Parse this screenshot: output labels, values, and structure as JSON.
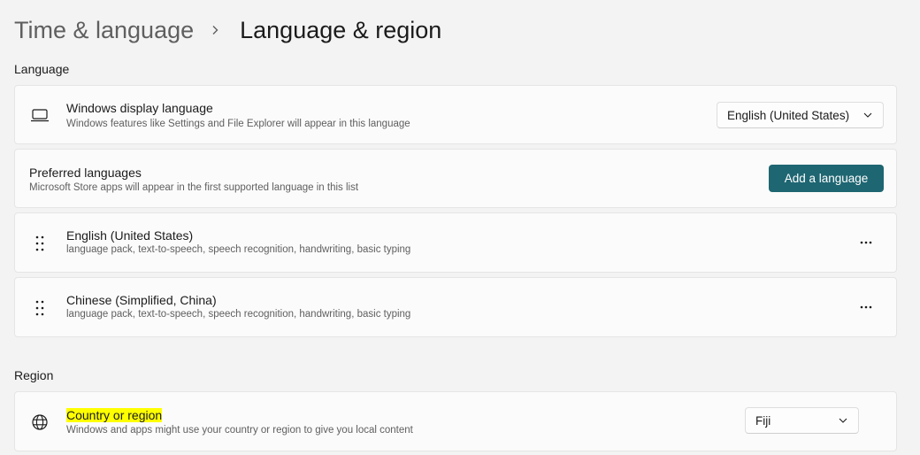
{
  "header": {
    "parent": "Time & language",
    "current": "Language & region"
  },
  "language_section": {
    "label": "Language",
    "display_language": {
      "icon": "laptop-icon",
      "title": "Windows display language",
      "subtitle": "Windows features like Settings and File Explorer will appear in this language",
      "selected": "English (United States)"
    },
    "preferred": {
      "title": "Preferred languages",
      "subtitle": "Microsoft Store apps will appear in the first supported language in this list",
      "add_button": "Add a language"
    },
    "languages": [
      {
        "name": "English (United States)",
        "features": "language pack, text-to-speech, speech recognition, handwriting, basic typing"
      },
      {
        "name": "Chinese (Simplified, China)",
        "features": "language pack, text-to-speech, speech recognition, handwriting, basic typing"
      }
    ]
  },
  "region_section": {
    "label": "Region",
    "country": {
      "icon": "globe-icon",
      "title": "Country or region",
      "subtitle": "Windows and apps might use your country or region to give you local content",
      "selected": "Fiji"
    }
  },
  "colors": {
    "accent": "#1e6672",
    "highlight": "#ffff00",
    "background": "#f3f3f3"
  }
}
